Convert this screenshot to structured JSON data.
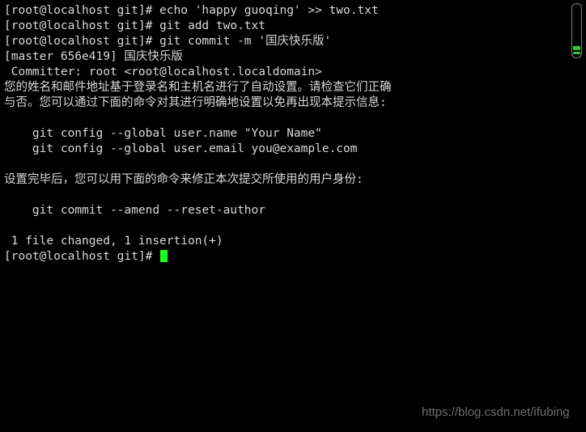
{
  "terminal": {
    "lines": [
      "[root@localhost git]# echo 'happy guoqing' >> two.txt",
      "[root@localhost git]# git add two.txt",
      "[root@localhost git]# git commit -m '国庆快乐版'",
      "[master 656e419] 国庆快乐版",
      " Committer: root <root@localhost.localdomain>",
      "您的姓名和邮件地址基于登录名和主机名进行了自动设置。请检查它们正确",
      "与否。您可以通过下面的命令对其进行明确地设置以免再出现本提示信息:",
      "",
      "    git config --global user.name \"Your Name\"",
      "    git config --global user.email you@example.com",
      "",
      "设置完毕后，您可以用下面的命令来修正本次提交所使用的用户身份:",
      "",
      "    git commit --amend --reset-author",
      "",
      " 1 file changed, 1 insertion(+)"
    ],
    "prompt": "[root@localhost git]# ",
    "cursor_color": "#1aff1a",
    "text_color": "#d8d8d8",
    "background_color": "#000000"
  },
  "scrollbar": {
    "thumb_color": "#2fc72f",
    "track_color": "#808080"
  },
  "watermark": {
    "text": "https://blog.csdn.net/ifubing",
    "color": "#6e6e6e"
  }
}
